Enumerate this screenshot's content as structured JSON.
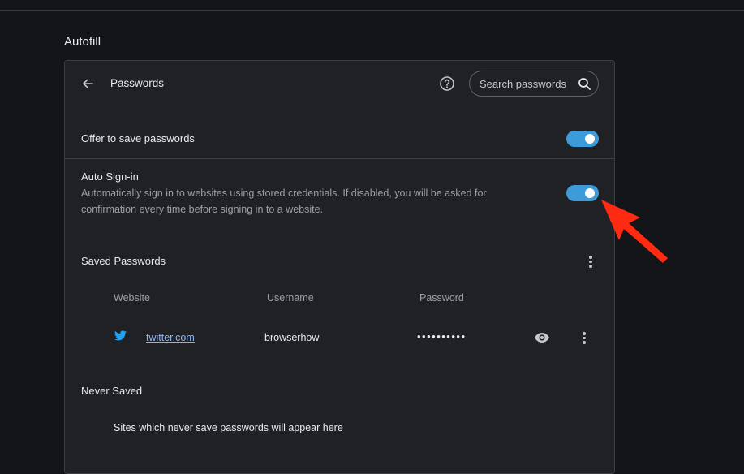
{
  "section": {
    "title": "Autofill"
  },
  "header": {
    "title": "Passwords",
    "search_placeholder": "Search passwords",
    "icons": {
      "back": "arrow-back-icon",
      "help": "help-circle-icon",
      "search": "search-icon"
    }
  },
  "settings": {
    "offer_to_save": {
      "label": "Offer to save passwords",
      "enabled": true
    },
    "auto_signin": {
      "label": "Auto Sign-in",
      "description": "Automatically sign in to websites using stored credentials. If disabled, you will be asked for confirmation every time before signing in to a website.",
      "enabled": true
    }
  },
  "saved_passwords": {
    "title": "Saved Passwords",
    "columns": [
      "Website",
      "Username",
      "Password"
    ],
    "rows": [
      {
        "site_icon": "twitter-bird-icon",
        "website": "twitter.com",
        "username": "browserhow",
        "password": "••••••••••"
      }
    ]
  },
  "never_saved": {
    "title": "Never Saved",
    "empty_text": "Sites which never save passwords will appear here"
  },
  "colors": {
    "accent": "#3d9bd9",
    "link": "#8ab4f8",
    "annotation_arrow": "#ff2a12",
    "twitter": "#1da1f2",
    "background": "#141518",
    "card": "#1f2125"
  }
}
